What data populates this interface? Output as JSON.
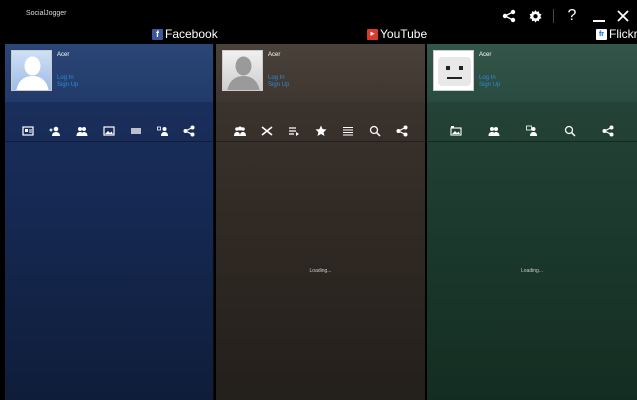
{
  "app": {
    "title": "SocialJogger"
  },
  "services": [
    {
      "name": "Facebook"
    },
    {
      "name": "YouTube"
    },
    {
      "name": "Flickr"
    }
  ],
  "panels": {
    "facebook": {
      "user": "Acer",
      "login": "Log In",
      "signup": "Sign Up",
      "status": ""
    },
    "youtube": {
      "user": "Acer",
      "login": "Log In",
      "signup": "Sign Up",
      "status": "Loading..."
    },
    "flickr": {
      "user": "Acer",
      "login": "Log In",
      "signup": "Sign Up",
      "status": "Loading..."
    }
  },
  "colors": {
    "facebook": "#1b2f5c",
    "youtube": "#362f29",
    "flickr": "#1f3d31",
    "link": "#2e8bd8"
  }
}
